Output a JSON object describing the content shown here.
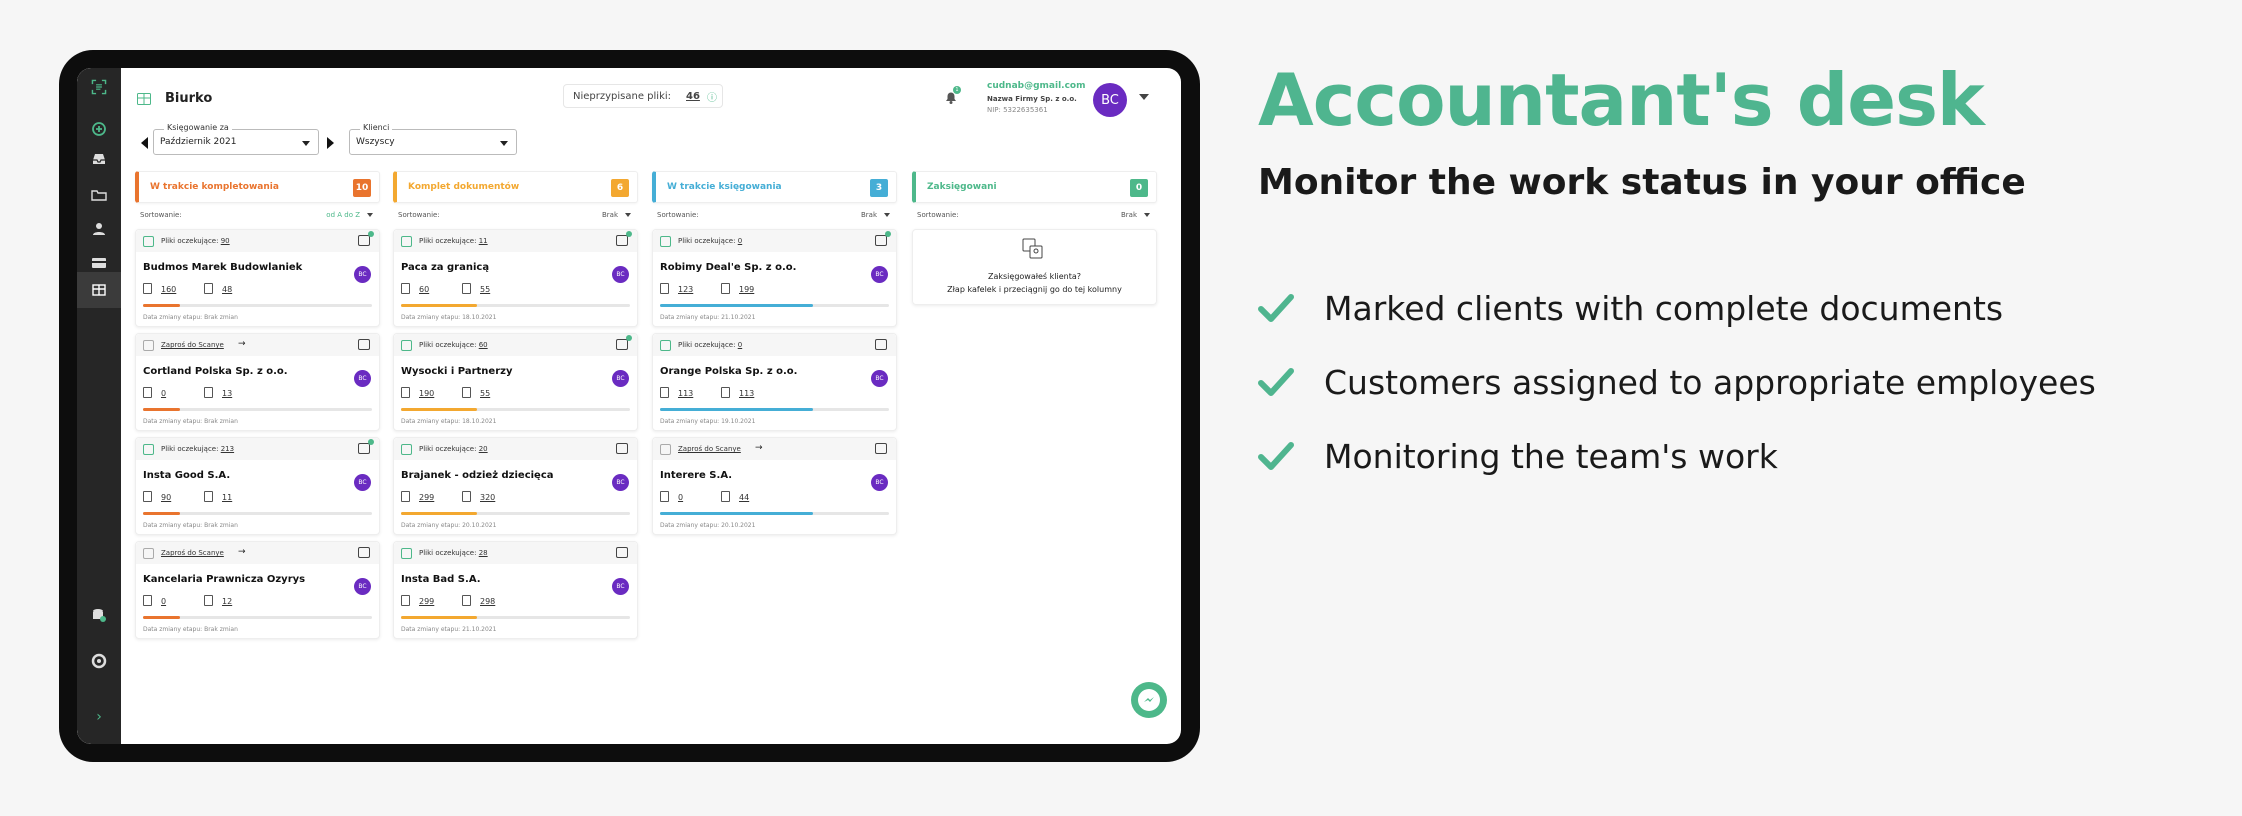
{
  "app": {
    "page_title": "Biurko",
    "unassigned_label": "Nieprzypisane pliki:",
    "unassigned_count": "46",
    "notifications_count": "1"
  },
  "user": {
    "email": "cudnab@gmail.com",
    "company": "Nazwa Firmy Sp. z o.o.",
    "nip": "NIP: 5322635361",
    "initials": "BC"
  },
  "filters": {
    "period_label": "Księgowanie za",
    "period_value": "Październik 2021",
    "clients_label": "Klienci",
    "clients_value": "Wszyscy"
  },
  "sort_label": "Sortowanie:",
  "columns": [
    {
      "title": "W trakcie kompletowania",
      "count": "10",
      "color": "#e9742e",
      "sort": "od A do Z",
      "cards": [
        {
          "top": "pending",
          "pending_label": "Pliki oczekujące:",
          "pending": "90",
          "msg_dot": true,
          "name": "Budmos Marek Budowlaniek",
          "in": "160",
          "out": "48",
          "progress": 0.16,
          "date": "Data zmiany etapu: Brak zmian"
        },
        {
          "top": "invite",
          "invite": "Zaproś do Scanye",
          "msg_dot": false,
          "name": "Cortland Polska Sp. z o.o.",
          "in": "0",
          "out": "13",
          "progress": 0.16,
          "date": "Data zmiany etapu: Brak zmian"
        },
        {
          "top": "pending",
          "pending_label": "Pliki oczekujące:",
          "pending": "213",
          "msg_dot": true,
          "name": "Insta Good S.A.",
          "in": "90",
          "out": "11",
          "progress": 0.16,
          "date": "Data zmiany etapu: Brak zmian"
        },
        {
          "top": "invite",
          "invite": "Zaproś do Scanye",
          "msg_dot": false,
          "name": "Kancelaria Prawnicza Ozyrys",
          "in": "0",
          "out": "12",
          "progress": 0.16,
          "date": "Data zmiany etapu: Brak zmian"
        }
      ]
    },
    {
      "title": "Komplet dokumentów",
      "count": "6",
      "color": "#f3a830",
      "sort": "Brak",
      "cards": [
        {
          "top": "pending",
          "pending_label": "Pliki oczekujące:",
          "pending": "11",
          "msg_dot": true,
          "name": "Paca za granicą",
          "in": "60",
          "out": "55",
          "progress": 0.33,
          "date": "Data zmiany etapu: 18.10.2021"
        },
        {
          "top": "pending",
          "pending_label": "Pliki oczekujące:",
          "pending": "60",
          "msg_dot": true,
          "name": "Wysocki i Partnerzy",
          "in": "190",
          "out": "55",
          "progress": 0.33,
          "date": "Data zmiany etapu: 18.10.2021"
        },
        {
          "top": "pending",
          "pending_label": "Pliki oczekujące:",
          "pending": "20",
          "msg_dot": false,
          "name": "Brajanek - odzież dziecięca",
          "in": "299",
          "out": "320",
          "progress": 0.33,
          "date": "Data zmiany etapu: 20.10.2021"
        },
        {
          "top": "pending",
          "pending_label": "Pliki oczekujące:",
          "pending": "28",
          "msg_dot": false,
          "name": "Insta Bad S.A.",
          "in": "299",
          "out": "298",
          "progress": 0.33,
          "date": "Data zmiany etapu: 21.10.2021"
        }
      ]
    },
    {
      "title": "W trakcie księgowania",
      "count": "3",
      "color": "#45aed6",
      "sort": "Brak",
      "cards": [
        {
          "top": "pending",
          "pending_label": "Pliki oczekujące:",
          "pending": "0",
          "msg_dot": true,
          "name": "Robimy Deal'e Sp. z o.o.",
          "in": "123",
          "out": "199",
          "progress": 0.67,
          "date": "Data zmiany etapu: 21.10.2021"
        },
        {
          "top": "pending",
          "pending_label": "Pliki oczekujące:",
          "pending": "0",
          "msg_dot": false,
          "name": "Orange Polska Sp. z o.o.",
          "in": "113",
          "out": "113",
          "progress": 0.67,
          "date": "Data zmiany etapu: 19.10.2021"
        },
        {
          "top": "invite",
          "invite": "Zaproś do Scanye",
          "msg_dot": false,
          "name": "Interere S.A.",
          "in": "0",
          "out": "44",
          "progress": 0.67,
          "date": "Data zmiany etapu: 20.10.2021"
        }
      ]
    },
    {
      "title": "Zaksięgowani",
      "count": "0",
      "color": "#4db88a",
      "sort": "Brak",
      "placeholder": {
        "line1": "Zaksięgowałeś klienta?",
        "line2": "Złap kafelek i przeciągnij go do tej kolumny"
      },
      "cards": []
    }
  ],
  "marketing": {
    "headline": "Accountant's desk",
    "subheadline": "Monitor the work status in your office",
    "features": [
      "Marked clients with complete documents",
      "Customers assigned to appropriate employees",
      "Monitoring the team's work"
    ]
  },
  "colors": {
    "accent": "#4fb58f",
    "avatar": "#6a2bc1"
  },
  "icons": {
    "sidebar": [
      "scanye-logo-icon",
      "add-icon",
      "inbox-icon",
      "folder-icon",
      "user-icon",
      "card-icon",
      "desk-icon",
      "database-icon",
      "help-icon",
      "expand-icon"
    ]
  }
}
